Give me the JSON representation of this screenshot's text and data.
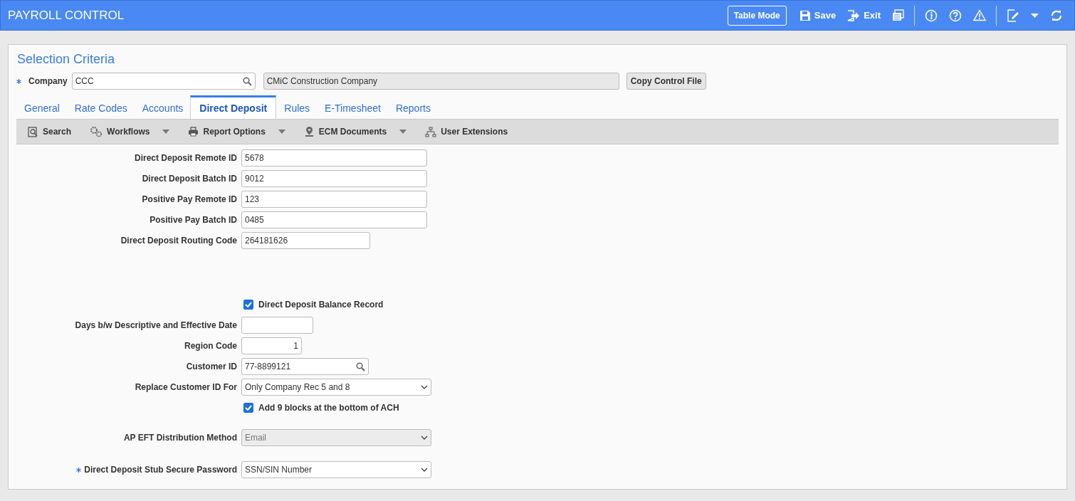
{
  "header": {
    "title": "PAYROLL CONTROL",
    "actions": [
      {
        "kind": "outlined",
        "label": "Table Mode"
      },
      {
        "kind": "save",
        "label": "Save"
      },
      {
        "kind": "exit",
        "label": "Exit"
      },
      {
        "kind": "copies"
      },
      {
        "kind": "divider"
      },
      {
        "kind": "info"
      },
      {
        "kind": "help"
      },
      {
        "kind": "warning"
      },
      {
        "kind": "divider"
      },
      {
        "kind": "edit"
      },
      {
        "kind": "caret"
      },
      {
        "kind": "refresh"
      }
    ]
  },
  "selection": {
    "title": "Selection Criteria",
    "company": {
      "label": "Company",
      "required": true,
      "value": "CCC",
      "name": "CMiC Construction Company"
    },
    "copy_button": "Copy Control File"
  },
  "tabs": [
    {
      "label": "General",
      "selected": false
    },
    {
      "label": "Rate Codes",
      "selected": false
    },
    {
      "label": "Accounts",
      "selected": false
    },
    {
      "label": "Direct Deposit",
      "selected": true
    },
    {
      "label": "Rules",
      "selected": false
    },
    {
      "label": "E-Timesheet",
      "selected": false
    },
    {
      "label": "Reports",
      "selected": false
    }
  ],
  "toolbar": [
    {
      "kind": "search",
      "label": "Search",
      "dropdown": false
    },
    {
      "kind": "workflows",
      "label": "Workflows",
      "dropdown": true
    },
    {
      "kind": "print",
      "label": "Report Options",
      "dropdown": true
    },
    {
      "kind": "ecm",
      "label": "ECM Documents",
      "dropdown": true
    },
    {
      "kind": "tree",
      "label": "User Extensions",
      "dropdown": false
    }
  ],
  "field_groups": [
    [
      {
        "kind": "text",
        "label": "Direct Deposit Remote ID",
        "value": "5678"
      },
      {
        "kind": "text",
        "label": "Direct Deposit Batch ID",
        "value": "9012"
      },
      {
        "kind": "text",
        "label": "Positive Pay Remote ID",
        "value": "123"
      },
      {
        "kind": "text",
        "label": "Positive Pay Batch ID",
        "value": "0485"
      },
      {
        "kind": "text",
        "label": "Direct Deposit Routing Code",
        "value": "264181626"
      }
    ],
    [
      {
        "kind": "checkbox",
        "label": "Direct Deposit Balance Record",
        "checked": true
      },
      {
        "kind": "text",
        "label": "Days b/w Descriptive and Effective Date"
      },
      {
        "kind": "number",
        "label": "Region Code",
        "value": "1"
      },
      {
        "kind": "lookup",
        "label": "Customer ID",
        "value": "77-8899121"
      },
      {
        "kind": "select",
        "label": "Replace Customer ID For",
        "value": "Only Company Rec 5 and 8",
        "disabled": false
      },
      {
        "kind": "checkbox",
        "label": "Add 9 blocks at the bottom of ACH",
        "checked": true
      }
    ],
    [
      {
        "kind": "select",
        "label": "AP EFT Distribution Method",
        "value": "Email",
        "disabled": true
      }
    ],
    [
      {
        "kind": "select",
        "label": "Direct Deposit Stub Secure Password",
        "value": "SSN/SIN Number",
        "disabled": false,
        "required": true
      }
    ]
  ]
}
